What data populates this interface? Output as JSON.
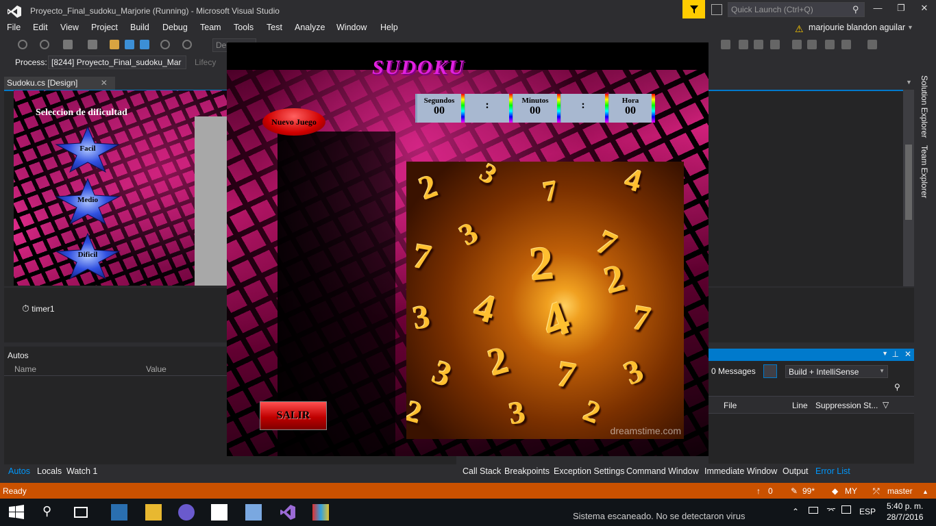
{
  "window": {
    "title": "Proyecto_Final_sudoku_Marjorie (Running) - Microsoft Visual Studio",
    "quick_launch_placeholder": "Quick Launch (Ctrl+Q)",
    "user": "marjourie blandon aguilar"
  },
  "menu": [
    "File",
    "Edit",
    "View",
    "Project",
    "Build",
    "Debug",
    "Team",
    "Tools",
    "Test",
    "Analyze",
    "Window",
    "Help"
  ],
  "toolbar": {
    "process_label": "Process:",
    "process_value": "[8244] Proyecto_Final_sudoku_Mar",
    "config_value": "Del",
    "lifecycle_label": "Lifecy"
  },
  "document": {
    "tab_label": "Sudoku.cs [Design]",
    "designer_form": {
      "heading": "Seleccion de dificultad",
      "levels": [
        "Facil",
        "Medio",
        "Dificil"
      ]
    },
    "component_tray": {
      "timer": "timer1"
    }
  },
  "right_strip": [
    "Solution Explorer",
    "Team Explorer"
  ],
  "autos": {
    "title": "Autos",
    "columns": [
      "Name",
      "Value"
    ]
  },
  "error_list": {
    "messages": "0 Messages",
    "filter_select": "Build + IntelliSense",
    "columns": [
      "File",
      "Line",
      "Suppression St..."
    ]
  },
  "bottom_tabs_left": [
    "Autos",
    "Locals",
    "Watch 1"
  ],
  "bottom_tabs_right": [
    "Call Stack",
    "Breakpoints",
    "Exception Settings",
    "Command Window",
    "Immediate Window",
    "Output",
    "Error List"
  ],
  "status": {
    "ready": "Ready",
    "up": "0",
    "edits": "99*",
    "repo": "MY",
    "branch": "master"
  },
  "taskbar": {
    "tray_text": "Sistema escaneado. No se detectaron virus",
    "lang": "ESP",
    "time": "5:40 p. m.",
    "date": "28/7/2016"
  },
  "sudoku_app": {
    "title": "SUDOKU",
    "new_game_label": "Nuevo Juego",
    "exit_label": "SALIR",
    "timer": {
      "seconds_label": "Segundos",
      "seconds_value": "00",
      "minutes_label": "Minutos",
      "minutes_value": "00",
      "hours_label": "Hora",
      "hours_value": "00",
      "separator": ":"
    },
    "watermark": "dreamstime.com"
  },
  "colors": {
    "accent": "#007acc",
    "status_bar": "#ca5100",
    "sudoku_title": "#e020e0"
  }
}
